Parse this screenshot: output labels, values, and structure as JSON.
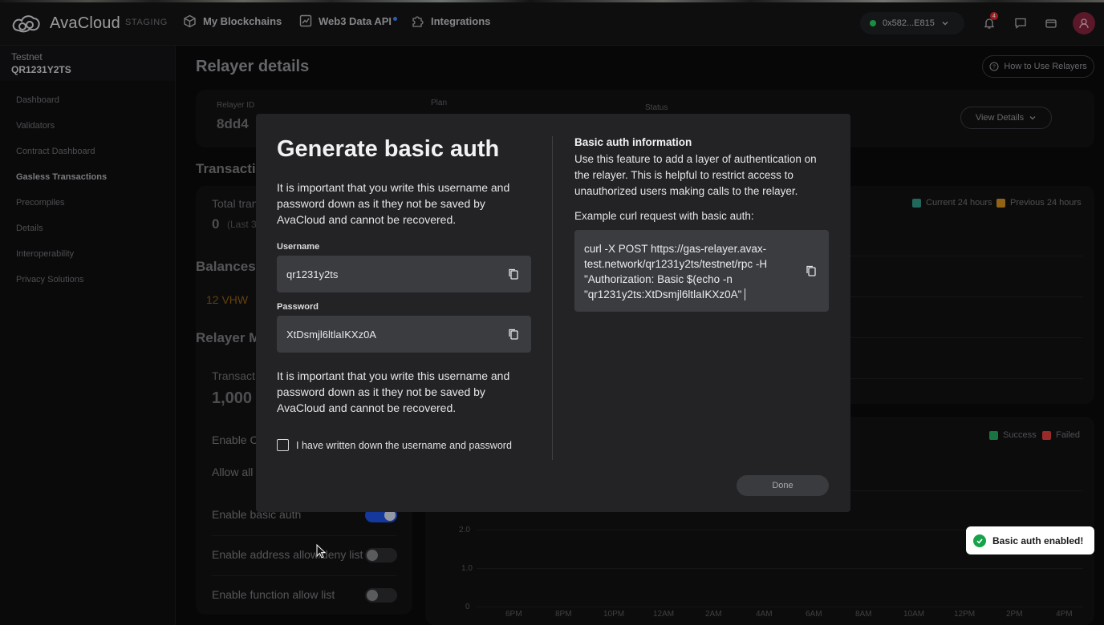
{
  "topnav": {
    "brand": "AvaCloud",
    "env": "STAGING",
    "items": [
      {
        "label": "My Blockchains",
        "icon": "cube-icon"
      },
      {
        "label": "Web3 Data API",
        "icon": "chart-icon"
      },
      {
        "label": "Integrations",
        "icon": "puzzle-icon"
      }
    ],
    "wallet": "0x582...E815",
    "notification_count": "4"
  },
  "sidebar": {
    "network": "Testnet",
    "chain_id": "QR1231Y2TS",
    "items": [
      {
        "label": "Dashboard"
      },
      {
        "label": "Validators"
      },
      {
        "label": "Contract Dashboard"
      },
      {
        "label": "Gasless Transactions"
      },
      {
        "label": "Precompiles"
      },
      {
        "label": "Details"
      },
      {
        "label": "Interoperability"
      },
      {
        "label": "Privacy Solutions"
      }
    ]
  },
  "main": {
    "title": "Relayer details",
    "how_to": "How to Use Relayers",
    "relayer_id_label": "Relayer ID",
    "relayer_id_value": "8dd4",
    "plan_label": "Plan",
    "status_label": "Status",
    "view_details": "View Details",
    "transactions_section": "Transacti",
    "total_label": "Total tran",
    "total_value": "0",
    "total_sub": "(Last 3",
    "legend_current": "Current 24 hours",
    "legend_previous": "Previous 24 hours",
    "balances_section": "Balances",
    "balance_value": "12 VHW",
    "relayer_m_section": "Relayer M",
    "transact_label": "Transact",
    "transact_value": "1,000",
    "enable_c": "Enable C",
    "allow_all": "Allow all",
    "enable_basic_auth": "Enable basic auth",
    "enable_address_list": "Enable address allow/deny list",
    "enable_function_list": "Enable function allow list",
    "legend_success": "Success",
    "legend_failed": "Failed",
    "y_ticks": [
      "2.0",
      "1.0",
      "0"
    ],
    "x_ticks": [
      "6PM",
      "8PM",
      "10PM",
      "12AM",
      "2AM",
      "4AM",
      "6AM",
      "8AM",
      "10AM",
      "12PM",
      "2PM",
      "4PM"
    ]
  },
  "modal": {
    "title": "Generate basic auth",
    "warning_top": "It is important that you write this username and password down as it they not be saved by AvaCloud and cannot be recovered.",
    "username_label": "Username",
    "username_value": "qr1231y2ts",
    "password_label": "Password",
    "password_value": "XtDsmjl6ltlaIKXz0A",
    "warning_bottom": "It is important that you write this username and password down as it they not be saved by AvaCloud and cannot be recovered.",
    "checkbox_label": "I have written down the username and password",
    "info_heading": "Basic auth information",
    "info_text": "Use this feature to add a layer of authentication on the relayer. This is helpful to restrict access to unauthorized users making calls to the relayer.",
    "example_label": "Example curl request with basic auth:",
    "curl": "curl -X POST https://gas-relayer.avax-test.network/qr1231y2ts/testnet/rpc -H \"Authorization: Basic $(echo -n \"qr1231y2ts:XtDsmjl6ltlaIKXz0A\"",
    "done": "Done"
  },
  "toast": {
    "text": "Basic auth enabled!"
  },
  "colors": {
    "modal_bg": "#232326",
    "input_bg": "#3b3c40",
    "toggle_on": "#1d4ed8",
    "success_green": "#16a34a",
    "legend_current": "#2f8f7f",
    "legend_previous": "#c98a20",
    "legend_success": "#22a35a",
    "legend_failed": "#d33b3b"
  }
}
